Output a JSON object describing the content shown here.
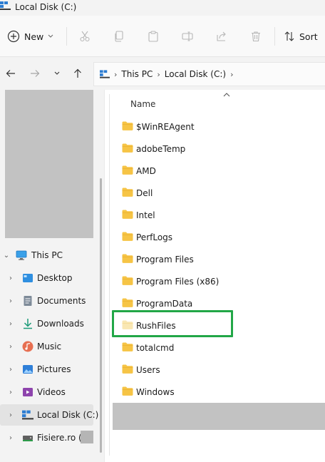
{
  "window": {
    "title": "Local Disk (C:)"
  },
  "commandbar": {
    "new_label": "New",
    "sort_label": "Sort"
  },
  "address": {
    "crumbs": [
      "This PC",
      "Local Disk (C:)"
    ]
  },
  "filelist": {
    "column_name": "Name",
    "items": [
      "$WinREAgent",
      "adobeTemp",
      "AMD",
      "Dell",
      "Intel",
      "PerfLogs",
      "Program Files",
      "Program Files (x86)",
      "ProgramData",
      "RushFiles",
      "totalcmd",
      "Users",
      "Windows"
    ],
    "highlighted_item": "RushFiles",
    "highlight_color": "#22a747",
    "folder_color": "#f6c445"
  },
  "sidebar": {
    "items": [
      {
        "label": "This PC",
        "icon": "monitor-icon"
      },
      {
        "label": "Desktop",
        "icon": "desktop-icon"
      },
      {
        "label": "Documents",
        "icon": "documents-icon"
      },
      {
        "label": "Downloads",
        "icon": "download-icon"
      },
      {
        "label": "Music",
        "icon": "music-icon"
      },
      {
        "label": "Pictures",
        "icon": "pictures-icon"
      },
      {
        "label": "Videos",
        "icon": "videos-icon"
      },
      {
        "label": "Local Disk (C:)",
        "icon": "drive-icon",
        "selected": true
      },
      {
        "label": "Fisiere.ro (\\\\",
        "icon": "network-drive-icon"
      }
    ]
  }
}
